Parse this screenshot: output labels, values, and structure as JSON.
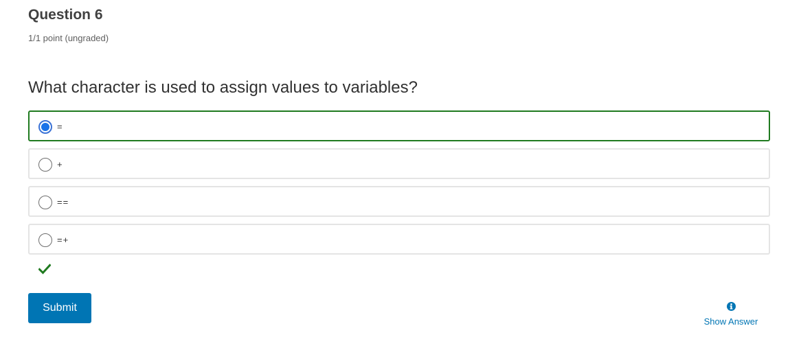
{
  "question": {
    "title": "Question 6",
    "points": "1/1 point (ungraded)",
    "prompt": "What character is used to assign values to variables?"
  },
  "options": [
    {
      "label": "=",
      "selected": true
    },
    {
      "label": "+",
      "selected": false
    },
    {
      "label": "==",
      "selected": false
    },
    {
      "label": "=+",
      "selected": false
    }
  ],
  "status": {
    "icon": "checkmark-icon",
    "color": "#1f7a1f"
  },
  "actions": {
    "submit_label": "Submit",
    "show_answer_label": "Show Answer",
    "show_answer_icon": "info-icon"
  },
  "colors": {
    "accent": "#0075b4",
    "correct": "#1f7a1f",
    "radio_selected": "#1a73e8"
  }
}
